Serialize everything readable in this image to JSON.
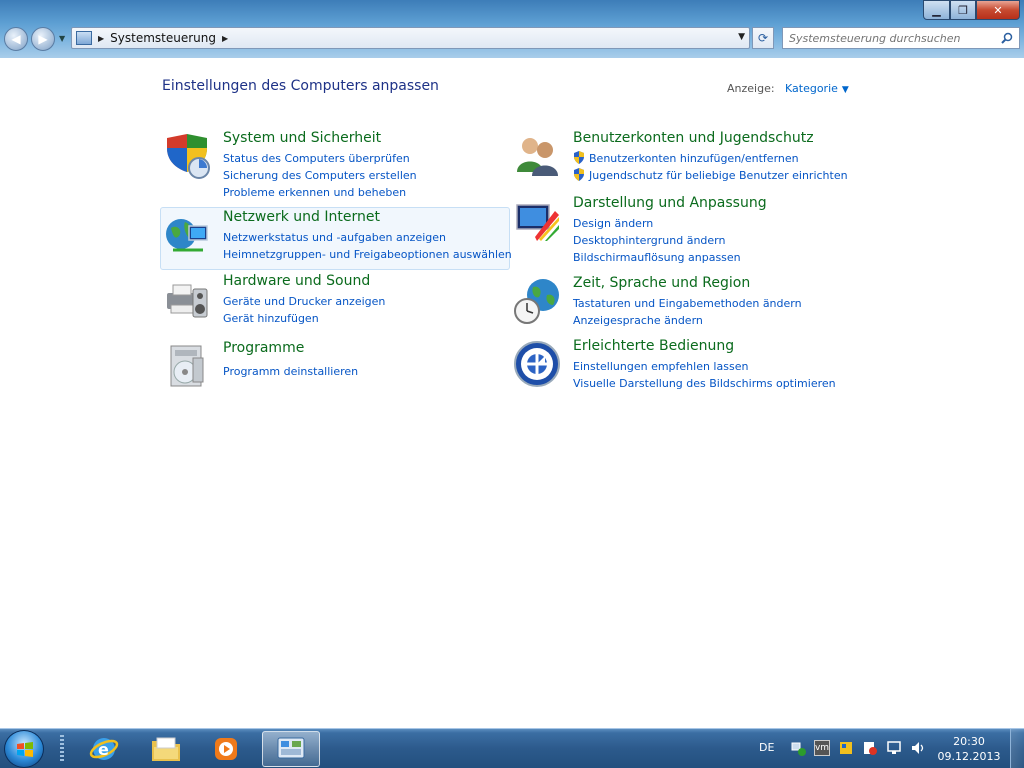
{
  "window": {
    "breadcrumb": "Systemsteuerung",
    "search_placeholder": "Systemsteuerung durchsuchen"
  },
  "content": {
    "title": "Einstellungen des Computers anpassen",
    "view_label": "Anzeige:",
    "view_value": "Kategorie"
  },
  "categories": [
    {
      "title": "System und Sicherheit",
      "icon": "shield-icon",
      "links": [
        "Status des Computers überprüfen",
        "Sicherung des Computers erstellen",
        "Probleme erkennen und beheben"
      ]
    },
    {
      "title": "Netzwerk und Internet",
      "icon": "network-globe-icon",
      "links": [
        "Netzwerkstatus und -aufgaben anzeigen",
        "Heimnetzgruppen- und Freigabeoptionen auswählen"
      ]
    },
    {
      "title": "Hardware und Sound",
      "icon": "printer-speaker-icon",
      "links": [
        "Geräte und Drucker anzeigen",
        "Gerät hinzufügen"
      ]
    },
    {
      "title": "Programme",
      "icon": "programs-disc-icon",
      "links": [
        "Programm deinstallieren"
      ]
    },
    {
      "title": "Benutzerkonten und Jugendschutz",
      "icon": "users-icon",
      "links": [
        "Benutzerkonten hinzufügen/entfernen",
        "Jugendschutz für beliebige Benutzer einrichten"
      ]
    },
    {
      "title": "Darstellung und Anpassung",
      "icon": "display-palette-icon",
      "links": [
        "Design ändern",
        "Desktophintergrund ändern",
        "Bildschirmauflösung anpassen"
      ]
    },
    {
      "title": "Zeit, Sprache und Region",
      "icon": "clock-globe-icon",
      "links": [
        "Tastaturen und Eingabemethoden ändern",
        "Anzeigesprache ändern"
      ]
    },
    {
      "title": "Erleichterte Bedienung",
      "icon": "accessibility-icon",
      "links": [
        "Einstellungen empfehlen lassen",
        "Visuelle Darstellung des Bildschirms optimieren"
      ]
    }
  ],
  "taskbar": {
    "language": "DE",
    "tray_vm_label": "vm",
    "time": "20:30",
    "date": "09.12.2013"
  }
}
